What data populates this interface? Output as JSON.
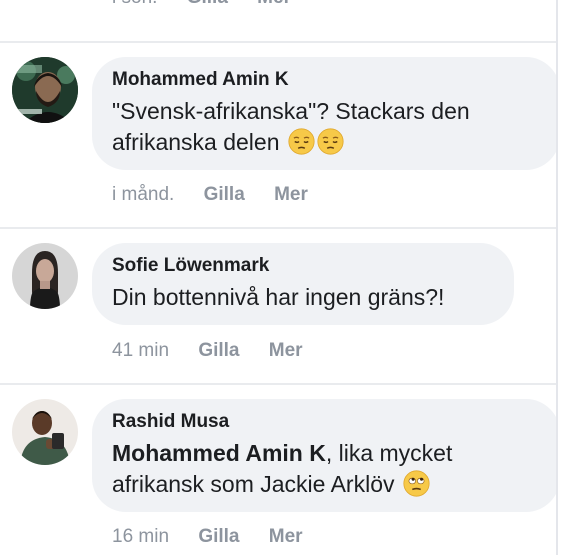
{
  "top_partial": {
    "time": "i son.",
    "like_label": "Gilla",
    "more_label": "Mer"
  },
  "comments": [
    {
      "author": "Mohammed Amin K",
      "text": "\"Svensk-afrikanska\"? Stackars den afrikanska delen",
      "emojis": [
        "pensive-face-icon",
        "pensive-face-icon"
      ],
      "time": "i månd.",
      "like_label": "Gilla",
      "more_label": "Mer"
    },
    {
      "author": "Sofie Löwenmark",
      "text": "Din bottennivå har ingen gräns?!",
      "time": "41 min",
      "like_label": "Gilla",
      "more_label": "Mer"
    },
    {
      "author": "Rashid Musa",
      "mention": "Mohammed Amin K",
      "text": ", lika mycket afrikansk som Jackie Arklöv",
      "emojis": [
        "eye-roll-face-icon"
      ],
      "time": "16 min",
      "like_label": "Gilla",
      "more_label": "Mer"
    }
  ],
  "colors": {
    "bubble": "#f0f2f5",
    "text": "#1c1e21",
    "muted": "#8d949e",
    "separator": "#e9ebee"
  }
}
